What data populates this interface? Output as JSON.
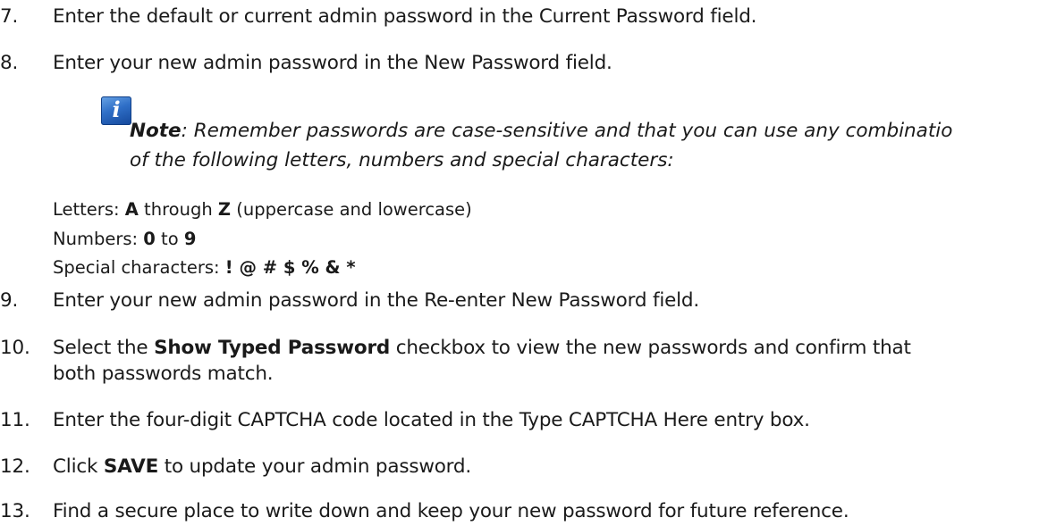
{
  "steps": [
    {
      "number": "7.",
      "text": "Enter the default or current admin password in the Current Password field."
    },
    {
      "number": "8.",
      "text": "Enter your new admin password in the New Password field."
    },
    {
      "number": "9.",
      "text": "Enter your new admin password in the Re-enter New Password field."
    },
    {
      "number": "10.",
      "pre": "Select the ",
      "bold": "Show Typed Password",
      "post": " checkbox to view the new passwords and confirm that",
      "line2": "both passwords match."
    },
    {
      "number": "11.",
      "text": "Enter the four-digit CAPTCHA code located in the Type CAPTCHA Here entry box."
    },
    {
      "number": "12.",
      "pre": "Click ",
      "bold": "SAVE",
      "post": " to update your admin password."
    },
    {
      "number": "13.",
      "text": "Find a secure place to write down and keep your new password for future reference."
    }
  ],
  "note": {
    "icon": "info-icon",
    "icon_glyph": "i",
    "label": "Note",
    "line1": ": Remember passwords are case-sensitive and that you can use any combinatio",
    "line2": "of the following letters, numbers and special characters:"
  },
  "characters": {
    "letters": {
      "label": "Letters: ",
      "from": "A",
      "mid": " through ",
      "to": "Z",
      "suffix": " (uppercase and lowercase)"
    },
    "numbers": {
      "label": "Numbers: ",
      "from": "0",
      "mid": " to ",
      "to": "9"
    },
    "special": {
      "label": "Special characters: ",
      "chars": "! @ # $ % & *"
    }
  },
  "colors": {
    "text": "#1a1a1a",
    "icon_blue": "#2f6fc7"
  }
}
